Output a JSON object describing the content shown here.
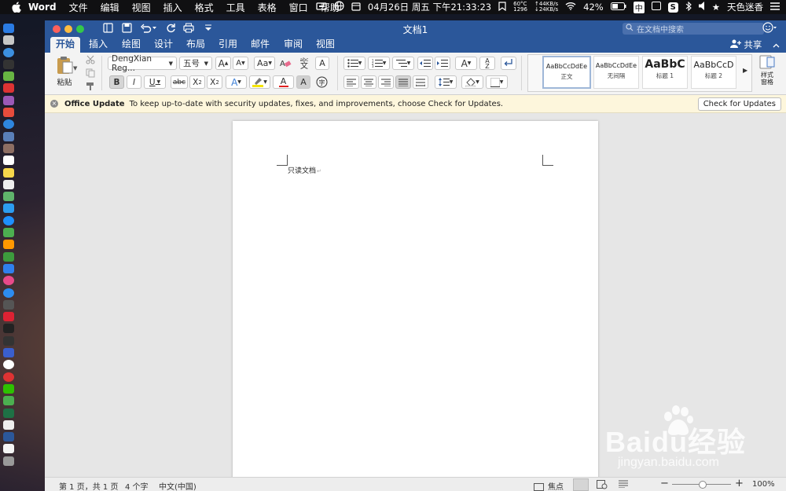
{
  "menubar": {
    "app_name": "Word",
    "menus": [
      "文件",
      "编辑",
      "视图",
      "插入",
      "格式",
      "工具",
      "表格",
      "窗口",
      "帮助"
    ],
    "datetime": "04月26日 周五 下午21:33:23",
    "temp": "60°C",
    "fan": "1296",
    "net_up": "↑44KB/s",
    "net_down": "↓24KB/s",
    "battery": "42%",
    "input_method": "中",
    "user": "天色迷香"
  },
  "window": {
    "title": "文档1",
    "search_placeholder": "在文档中搜索",
    "share_label": "共享"
  },
  "ribbon": {
    "tabs": [
      "开始",
      "插入",
      "绘图",
      "设计",
      "布局",
      "引用",
      "邮件",
      "审阅",
      "视图"
    ],
    "active_tab": "开始",
    "paste_label": "粘贴",
    "font_name": "DengXian Reg...",
    "font_size": "五号",
    "styles": [
      {
        "preview": "AaBbCcDdEe",
        "name": "正文"
      },
      {
        "preview": "AaBbCcDdEe",
        "name": "无间隔"
      },
      {
        "preview": "AaBbC",
        "name": "标题 1"
      },
      {
        "preview": "AaBbCcD",
        "name": "标题 2"
      }
    ],
    "styles_pane_label": "样式\n窗格"
  },
  "update_bar": {
    "title": "Office Update",
    "message": "To keep up-to-date with security updates, fixes, and improvements, choose Check for Updates.",
    "button": "Check for Updates"
  },
  "document": {
    "text": "只读文档"
  },
  "status": {
    "page": "第 1 页，共 1 页",
    "words": "4 个字",
    "language": "中文(中国)",
    "focus": "焦点",
    "zoom": "100%"
  },
  "watermark": {
    "brand": "Baidu经验",
    "url": "jingyan.baidu.com"
  },
  "colors": {
    "word_blue": "#2b579a",
    "update_bar": "#fdf6dc",
    "menubar": "#101012"
  }
}
